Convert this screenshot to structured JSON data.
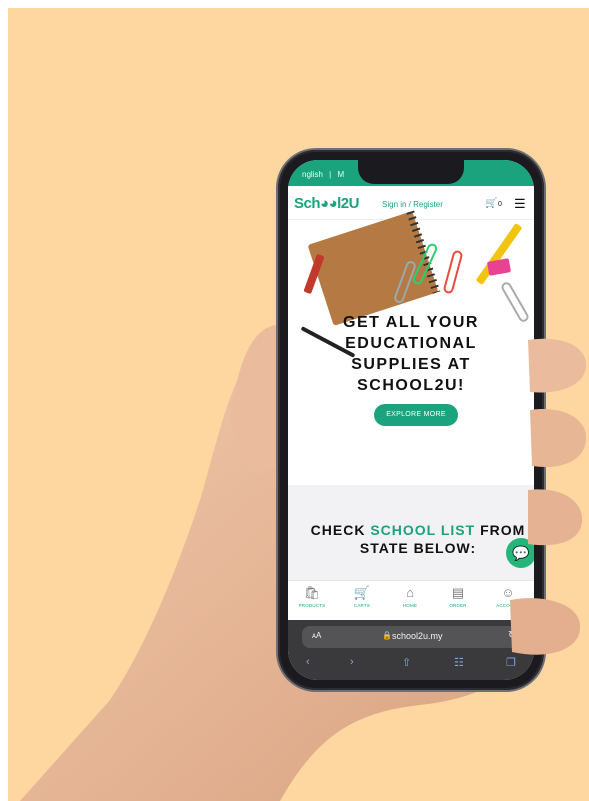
{
  "colors": {
    "background": "#fdd79f",
    "brand": "#1aa37c",
    "phone_body": "#1b1b1f",
    "skin": "#e7b89a"
  },
  "topbar": {
    "language_1": "nglish",
    "separator": "|",
    "language_2": "M"
  },
  "header": {
    "logo": "Sch◕◕l2U",
    "signin": "Sign in / Register",
    "cart_icon": "cart-icon",
    "cart_count": "0",
    "menu_icon": "hamburger-icon"
  },
  "hero": {
    "title_lines": [
      "GET ALL YOUR",
      "EDUCATIONAL",
      "SUPPLIES AT",
      "SCHOOL2U!"
    ],
    "button": "EXPLORE MORE"
  },
  "school_list": {
    "title_prefix": "CHECK ",
    "title_highlight": "SCHOOL LIST",
    "title_suffix": " FROM",
    "title_line2": "STATE BELOW:"
  },
  "chat": {
    "icon": "chat-bubble-icon"
  },
  "bottom_nav": [
    {
      "icon": "bag-icon",
      "label": "PRODUCTS"
    },
    {
      "icon": "cart-icon",
      "label": "CARTS"
    },
    {
      "icon": "home-icon",
      "label": "HOME"
    },
    {
      "icon": "receipt-icon",
      "label": "ORDER"
    },
    {
      "icon": "user-icon",
      "label": "ACCOUNT"
    }
  ],
  "safari": {
    "aa": "ᴀA",
    "url": "school2u.my",
    "lock_icon": "lock-icon",
    "reload_icon": "reload-icon",
    "toolbar_icons": [
      "back-icon",
      "forward-icon",
      "share-icon",
      "bookmarks-icon",
      "tabs-icon"
    ]
  }
}
